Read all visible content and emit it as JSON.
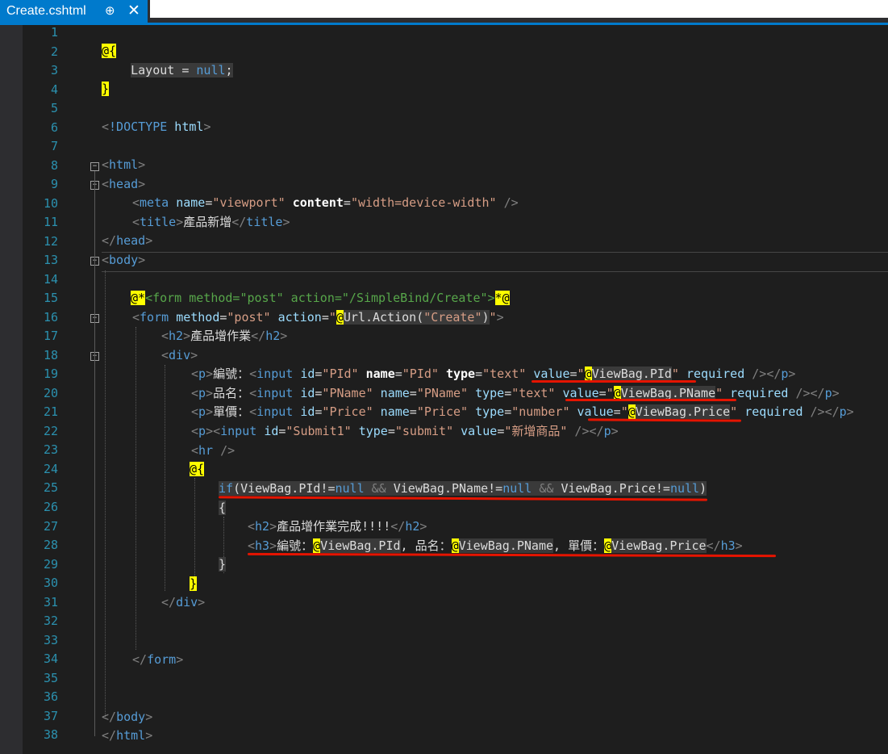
{
  "tab": {
    "title": "Create.cshtml",
    "pin_glyph": "⊕",
    "close_glyph": "✕"
  },
  "gutter": {
    "numbers": [
      "1",
      "2",
      "3",
      "4",
      "5",
      "6",
      "7",
      "8",
      "9",
      "10",
      "11",
      "12",
      "13",
      "14",
      "15",
      "16",
      "17",
      "18",
      "19",
      "20",
      "21",
      "22",
      "23",
      "24",
      "25",
      "26",
      "27",
      "28",
      "29",
      "30",
      "31",
      "32",
      "33",
      "34",
      "35",
      "36",
      "37",
      "38"
    ]
  },
  "code": {
    "l2_razor": "@{",
    "l3_layout": "Layout",
    "l3_eq": " = ",
    "l3_null": "null",
    "l3_semi": ";",
    "l4_razor": "}",
    "l6_lt": "<",
    "l6_doctype": "!DOCTYPE",
    "l6_html": " html",
    "l6_gt": ">",
    "l8_tag": "html",
    "l9_tag": "head",
    "l10_tag": "meta",
    "l10_name": "name",
    "l10_name_val": "\"viewport\"",
    "l10_content": "content",
    "l10_content_val": "\"width=device-width\"",
    "l10_end": " />",
    "l11_tag": "title",
    "l11_text": "產品新增",
    "l11_close": "title",
    "l12_tag": "head",
    "l13_tag": "body",
    "l15_open": "@*",
    "l15_comment": "<form method=\"post\" action=\"/SimpleBind/Create\">",
    "l15_close": "*@",
    "l16_tag": "form",
    "l16_method": "method",
    "l16_method_val": "\"post\"",
    "l16_action": "action",
    "l16_q1": "\"",
    "l16_at": "@",
    "l16_url": "Url.Action(",
    "l16_create": "\"Create\"",
    "l16_paren": ")",
    "l16_q2": "\"",
    "l17_tag": "h2",
    "l17_text": "產品增作業",
    "l17_close": "h2",
    "l18_tag": "div",
    "l19_label": "編號：",
    "l19_id_val": "\"PId\"",
    "l19_name_val": "\"PId\"",
    "l19_type_val": "\"text\"",
    "l19_expr": "ViewBag.PId",
    "l20_label": "品名：",
    "l20_id_val": "\"PName\"",
    "l20_name_val": "\"PName\"",
    "l20_type_val": "\"text\"",
    "l20_expr": "ViewBag.PName",
    "l21_label": "單價：",
    "l21_id_val": "\"Price\"",
    "l21_name_val": "\"Price\"",
    "l21_type_val": "\"number\"",
    "l21_expr": "ViewBag.Price",
    "l22_id_val": "\"Submit1\"",
    "l22_type_val": "\"submit\"",
    "l22_value_val": "\"新增商品\"",
    "l23_tag": "hr",
    "l24_razor": "@{",
    "l25_if": "if",
    "l25_a": "(ViewBag.PId!=",
    "l25_null1": "null",
    "l25_and1": " && ",
    "l25_b": "ViewBag.PName!=",
    "l25_null2": "null",
    "l25_and2": " && ",
    "l25_c": "ViewBag.Price!=",
    "l25_null3": "null",
    "l25_d": ")",
    "l26_brace": "{",
    "l27_tag": "h2",
    "l27_text": "產品增作業完成!!!!",
    "l28_tag": "h3",
    "l28_t1": "編號：",
    "l28_e1": "ViewBag.PId",
    "l28_t2": ", 品名：",
    "l28_e2": "ViewBag.PName",
    "l28_t3": ", 單價：",
    "l28_e3": "ViewBag.Price",
    "l29_brace": "}",
    "l30_razor": "}",
    "l31_tag": "div",
    "l34_tag": "form",
    "l37_tag": "body",
    "l38_tag": "html",
    "w_p": "p",
    "w_input": "input",
    "w_id": "id",
    "w_name": "name",
    "w_type": "type",
    "w_value": "value",
    "w_required": "required",
    "w_at": "@",
    "w_lt": "<",
    "w_gt": ">",
    "w_ltslash": "</",
    "w_eq": "=",
    "w_q": "\"",
    "w_selfclose": " /></",
    "w_selfclose2": " />",
    "w_space": " "
  }
}
